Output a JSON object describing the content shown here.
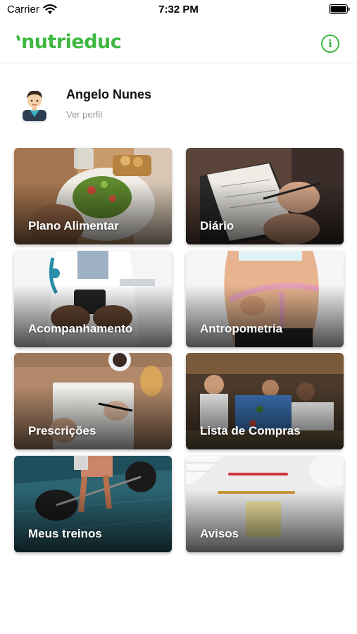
{
  "status_bar": {
    "carrier": "Carrier",
    "time": "7:32 PM"
  },
  "header": {
    "logo": "nutrieduc",
    "info_icon": "i",
    "accent_color": "#3fb841"
  },
  "profile": {
    "name": "Angelo Nunes",
    "link": "Ver perfil"
  },
  "tiles": [
    {
      "label": "Plano Alimentar",
      "icon": "salad-photo"
    },
    {
      "label": "Diário",
      "icon": "notebook-photo"
    },
    {
      "label": "Acompanhamento",
      "icon": "doctor-photo"
    },
    {
      "label": "Antropometria",
      "icon": "measuring-tape-photo"
    },
    {
      "label": "Prescrições",
      "icon": "writing-photo"
    },
    {
      "label": "Lista de Compras",
      "icon": "market-photo"
    },
    {
      "label": "Meus treinos",
      "icon": "weightlifting-photo"
    },
    {
      "label": "Avisos",
      "icon": "desk-notes-photo"
    }
  ]
}
